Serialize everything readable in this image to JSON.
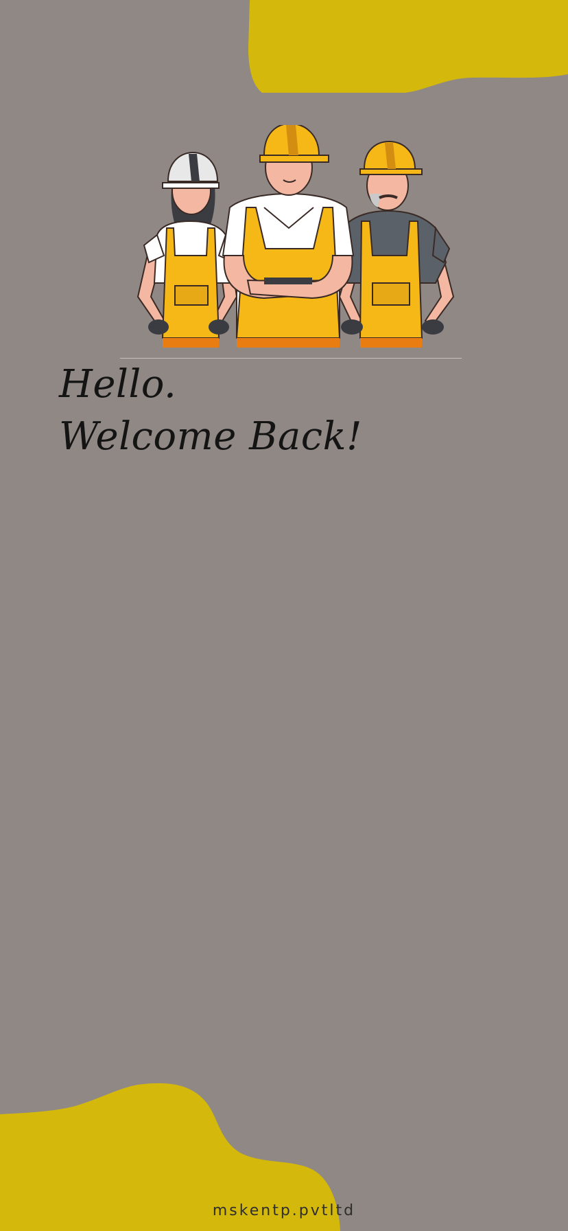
{
  "theme": {
    "background": "#8f8884",
    "accent": "#d4b90c",
    "text": "#151414"
  },
  "hero": {
    "illustration": "construction-workers-illustration"
  },
  "greeting": {
    "line1": "Hello.",
    "line2": "Welcome Back!"
  },
  "footer": {
    "text": "mskentp.pvtltd"
  }
}
